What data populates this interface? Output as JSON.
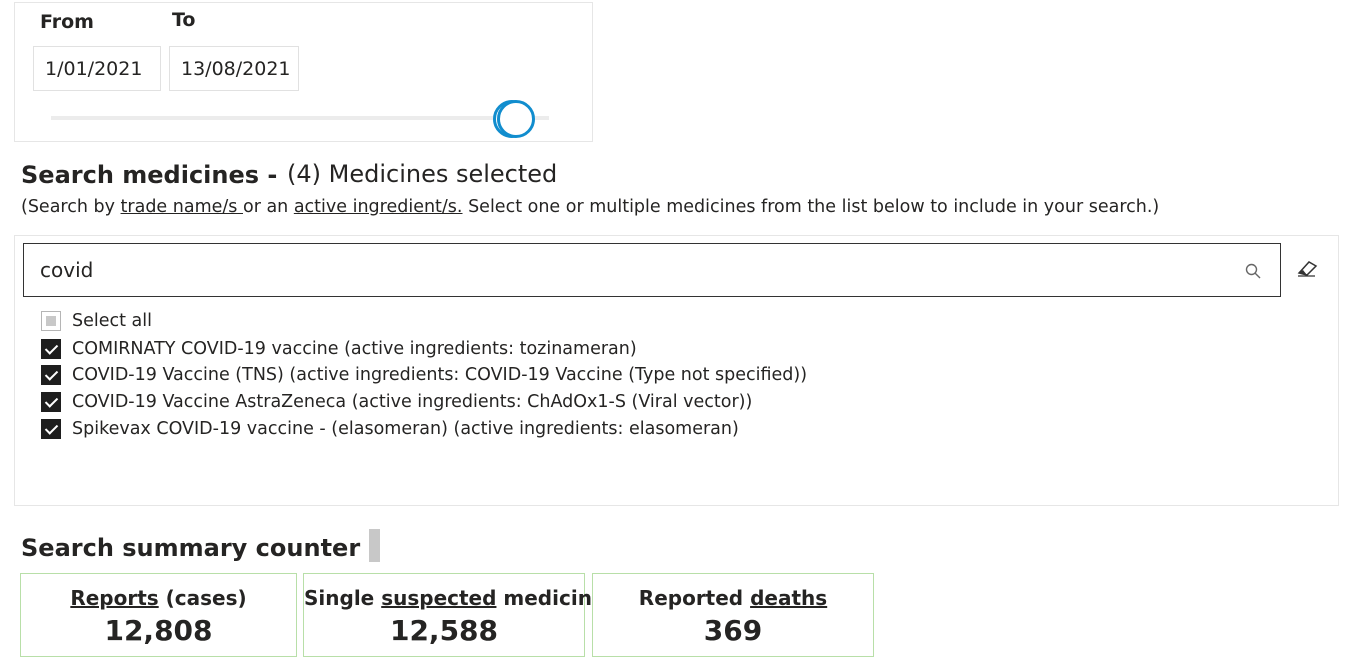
{
  "date_range": {
    "from_label": "From",
    "to_label": "To",
    "from_value": "1/01/2021",
    "to_value": "13/08/2021",
    "slider_start_fraction": 1.0,
    "slider_end_fraction": 1.0
  },
  "search": {
    "title": "Search medicines -",
    "selected_count": "(4) Medicines selected",
    "hint_prefix": "(Search by ",
    "hint_trade_name": "trade name/s ",
    "hint_or": "or an ",
    "hint_active": "active ingredient/s.",
    "hint_suffix": " Select one or multiple medicines from the list below to include in your search.)",
    "query": "covid",
    "search_icon": "search-icon",
    "clear_icon": "eraser-icon"
  },
  "options": {
    "select_all": "Select all",
    "items": [
      "COMIRNATY COVID-19 vaccine (active ingredients: tozinameran)",
      "COVID-19 Vaccine (TNS) (active ingredients: COVID-19 Vaccine (Type not specified))",
      "COVID-19 Vaccine AstraZeneca (active ingredients: ChAdOx1-S (Viral vector))",
      "Spikevax COVID-19 vaccine - (elasomeran) (active ingredients: elasomeran)"
    ]
  },
  "summary": {
    "title": "Search summary counter",
    "cards": [
      {
        "label_pre": "",
        "label_link": "Reports",
        "label_post": " (cases)",
        "value": "12,808"
      },
      {
        "label_pre": "Single ",
        "label_link": "suspected",
        "label_post": " medicine",
        "value": "12,588"
      },
      {
        "label_pre": "Reported ",
        "label_link": "deaths",
        "label_post": "",
        "value": "369"
      }
    ]
  },
  "colors": {
    "accent": "#118dce",
    "card_border": "#b8dfa8",
    "text": "#252423"
  }
}
